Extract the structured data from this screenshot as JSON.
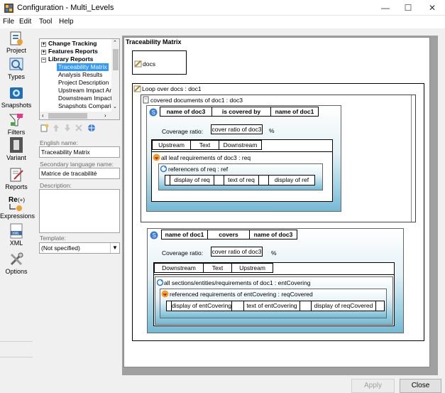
{
  "window": {
    "title": "Configuration - Multi_Levels",
    "controls": {
      "minimize": "—",
      "maximize": "☐",
      "close": "✕"
    }
  },
  "menu": [
    "File",
    "Edit",
    "Tool",
    "Help"
  ],
  "toolbar": [
    {
      "label": "Project",
      "icon": "project-icon"
    },
    {
      "label": "Types",
      "icon": "types-icon"
    },
    {
      "label": "Snapshots",
      "icon": "snapshots-icon"
    },
    {
      "label": "Filters",
      "icon": "filters-icon"
    },
    {
      "label": "Variant",
      "icon": "variant-icon"
    },
    {
      "label": "Reports",
      "icon": "reports-icon"
    },
    {
      "label": "Expressions",
      "icon": "expressions-icon"
    },
    {
      "label": "XML",
      "icon": "xml-icon"
    },
    {
      "label": "Options",
      "icon": "options-icon"
    }
  ],
  "tree": {
    "items": [
      {
        "label": "Change Tracking",
        "level": 0,
        "expander": "+",
        "bold": true
      },
      {
        "label": "Features Reports",
        "level": 0,
        "expander": "+",
        "bold": true
      },
      {
        "label": "Library Reports",
        "level": 0,
        "expander": "−",
        "bold": true
      },
      {
        "label": "Traceability Matrix",
        "level": 1,
        "selected": true
      },
      {
        "label": "Analysis Results",
        "level": 1
      },
      {
        "label": "Project Description",
        "level": 1
      },
      {
        "label": "Upstream Impact An",
        "level": 1
      },
      {
        "label": "Downstream Impact",
        "level": 1
      },
      {
        "label": "Snapshots Comparis",
        "level": 1
      }
    ]
  },
  "properties": {
    "english_label": "English name:",
    "english_value": "Traceability Matrix",
    "secondary_label": "Secondary language name:",
    "secondary_value": "Matrice de tracabilité",
    "description_label": "Description:",
    "description_value": "",
    "template_label": "Template:",
    "template_value": "(Not specified)"
  },
  "canvas": {
    "title": "Traceability Matrix",
    "docs_label": "docs",
    "loop_label": "Loop over docs : doc1",
    "covered_label": "covered documents of doc1 : doc3",
    "block1": {
      "header": [
        "name of doc3",
        "is covered by",
        "name of doc1"
      ],
      "coverage_label": "Coverage ratio:",
      "coverage_value": "cover ratio of doc3",
      "percent": "%",
      "tabs": [
        "Upstream",
        "Text",
        "Downstream"
      ],
      "loop1_label": "all leaf requirements of doc3 : req",
      "loop2_label": "referencers of req : ref",
      "row": [
        "display of req",
        "text of req",
        "display of ref"
      ]
    },
    "block2": {
      "header": [
        "name of doc1",
        "covers",
        "name of doc3"
      ],
      "coverage_label": "Coverage ratio:",
      "coverage_value": "cover ratio of doc3",
      "percent": "%",
      "tabs": [
        "Downstream",
        "Text",
        "Upstream"
      ],
      "loop1_label": "all sections/entities/requirements of doc1 : entCovering",
      "loop2_label": "referenced requirements of entCovering : reqCovered",
      "row": [
        "display of entCovering",
        "text of entCovering",
        "display of reqCovered"
      ]
    }
  },
  "buttons": {
    "apply": "Apply",
    "close": "Close"
  }
}
